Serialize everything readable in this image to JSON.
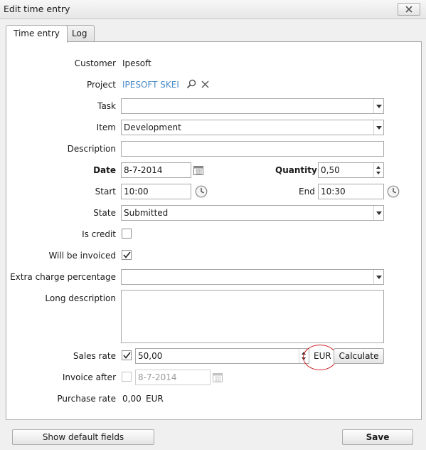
{
  "window": {
    "title": "Edit time entry"
  },
  "tabs": [
    {
      "label": "Time entry",
      "active": true
    },
    {
      "label": "Log",
      "active": false
    }
  ],
  "form": {
    "customer": {
      "label": "Customer",
      "value": "Ipesoft"
    },
    "project": {
      "label": "Project",
      "value": "IPESOFT SKEI"
    },
    "task": {
      "label": "Task",
      "value": ""
    },
    "item": {
      "label": "Item",
      "value": "Development"
    },
    "description": {
      "label": "Description",
      "value": ""
    },
    "date": {
      "label": "Date",
      "value": "8-7-2014"
    },
    "quantity": {
      "label": "Quantity",
      "value": "0,50"
    },
    "start": {
      "label": "Start",
      "value": "10:00"
    },
    "end": {
      "label": "End",
      "value": "10:30"
    },
    "state": {
      "label": "State",
      "value": "Submitted"
    },
    "is_credit": {
      "label": "Is credit",
      "checked": false
    },
    "will_be_invoiced": {
      "label": "Will be invoiced",
      "checked": true
    },
    "extra_charge": {
      "label": "Extra charge percentage",
      "value": ""
    },
    "long_description": {
      "label": "Long description",
      "value": ""
    },
    "sales_rate": {
      "label": "Sales rate",
      "checked": true,
      "value": "50,00",
      "currency": "EUR",
      "calculate_label": "Calculate"
    },
    "invoice_after": {
      "label": "Invoice after",
      "checked": false,
      "value": "8-7-2014"
    },
    "purchase_rate": {
      "label": "Purchase rate",
      "value": "0,00",
      "currency": "EUR"
    }
  },
  "footer": {
    "show_default_fields_label": "Show default fields",
    "save_label": "Save"
  },
  "icons": {
    "search": "search-icon",
    "clear": "close-icon",
    "calendar": "calendar-icon",
    "clock": "clock-icon",
    "dropdown": "chevron-down-icon"
  },
  "colors": {
    "link": "#4a8cc9",
    "annotation": "#cc2222"
  }
}
